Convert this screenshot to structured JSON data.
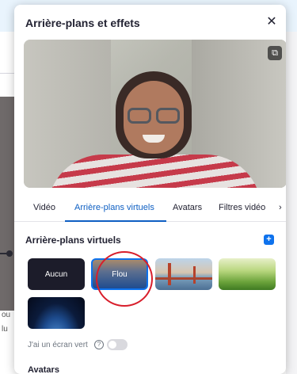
{
  "background_app": {
    "left_text_1": "ou",
    "left_text_2": "lu"
  },
  "dialog": {
    "title": "Arrière-plans et effets",
    "close_glyph": "✕",
    "copy_icon_glyph": "⧉"
  },
  "tabs": [
    {
      "label": "Vidéo",
      "active": false
    },
    {
      "label": "Arrière-plans virtuels",
      "active": true
    },
    {
      "label": "Avatars",
      "active": false
    },
    {
      "label": "Filtres vidéo",
      "active": false
    }
  ],
  "tabs_more_glyph": "›",
  "virtual_backgrounds": {
    "title": "Arrière-plans virtuels",
    "add_glyph": "+",
    "items": [
      {
        "label": "Aucun",
        "selected": false
      },
      {
        "label": "Flou",
        "selected": true
      },
      {
        "label": "",
        "image": "golden-gate-bridge"
      },
      {
        "label": "",
        "image": "grass"
      },
      {
        "label": "",
        "image": "earth-from-space"
      }
    ],
    "green_screen_label": "J'ai un écran vert",
    "help_glyph": "?",
    "green_screen_enabled": false
  },
  "avatars_section": {
    "title": "Avatars"
  },
  "colors": {
    "accent": "#0e72ed",
    "active_tab": "#0e5fc3",
    "annotation_circle": "#d81e2b"
  }
}
